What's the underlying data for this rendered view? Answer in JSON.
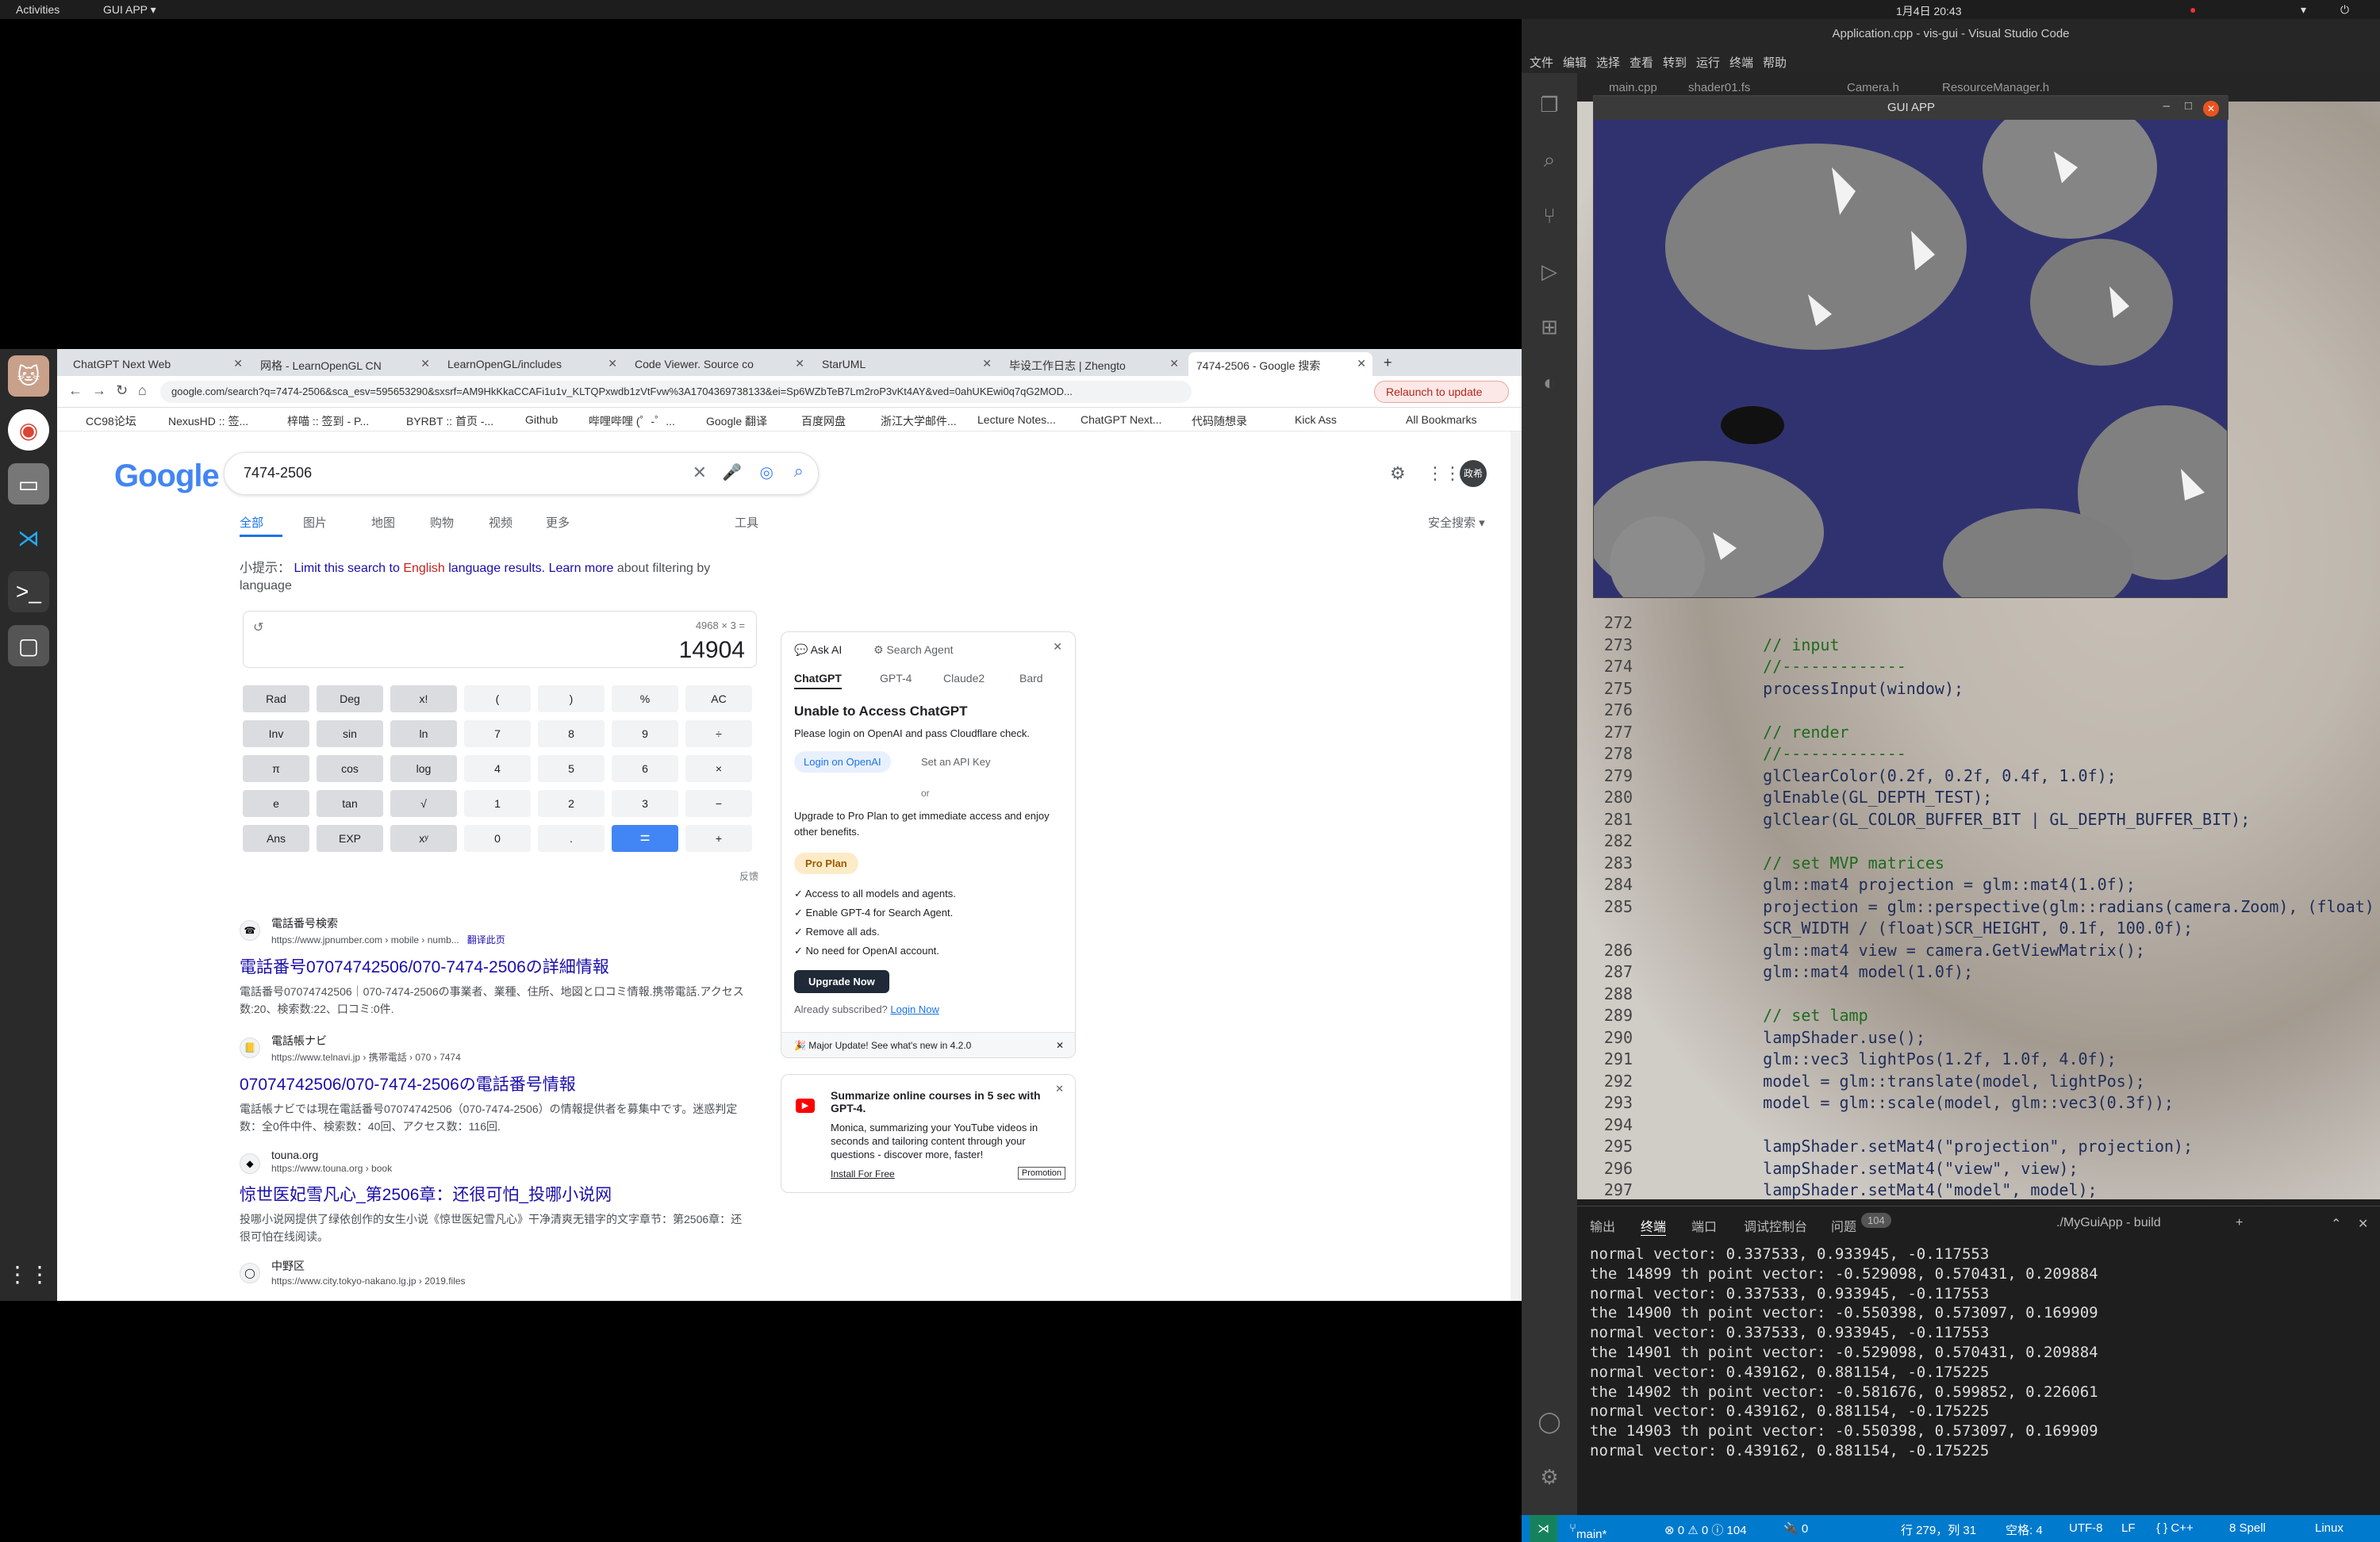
{
  "topbar": {
    "activities": "Activities",
    "app_menu": "GUI APP ▾",
    "datetime": "1月4日  20:43"
  },
  "chrome": {
    "tabs": [
      {
        "label": "ChatGPT Next Web"
      },
      {
        "label": "网格 - LearnOpenGL CN"
      },
      {
        "label": "LearnOpenGL/includes"
      },
      {
        "label": "Code Viewer. Source co"
      },
      {
        "label": "StarUML"
      },
      {
        "label": "毕设工作日志 | Zhengto"
      },
      {
        "label": "7474-2506 - Google 搜索"
      }
    ],
    "url": "google.com/search?q=7474-2506&sca_esv=595653290&sxsrf=AM9HkKkaCCAFi1u1v_KLTQPxwdb1zVtFvw%3A1704369738133&ei=Sp6WZbTeB7Lm2roP3vKt4AY&ved=0ahUKEwi0q7qG2MOD...",
    "relaunch": "Relaunch to update",
    "bookmarks": [
      "CC98论坛",
      "NexusHD :: 签...",
      "梓喵 :: 签到 - P...",
      "BYRBT :: 首页 -...",
      "Github",
      "哔哩哔哩 (゜-゜...",
      "Google 翻译",
      "百度网盘",
      "浙江大学邮件...",
      "Lecture Notes...",
      "ChatGPT Next...",
      "代码随想录",
      "Kick Ass",
      "All Bookmarks"
    ]
  },
  "google": {
    "logo": "Google",
    "query": "7474-2506",
    "nav": [
      "全部",
      "图片",
      "地图",
      "购物",
      "视频",
      "更多"
    ],
    "tools": "工具",
    "safesearch": "安全搜索 ▾",
    "avatar": "政希",
    "hint_prefix": "小提示：",
    "hint_link1": "Limit this search to",
    "hint_lang": "English",
    "hint_link2": "language results.",
    "hint_link3": "Learn more",
    "hint_suffix": "about filtering by language",
    "calc_expr": "4968 × 3 =",
    "calc_result": "14904",
    "calc_keys": [
      "Rad",
      "Deg",
      "x!",
      "(",
      ")",
      "%",
      "AC",
      "Inv",
      "sin",
      "ln",
      "7",
      "8",
      "9",
      "÷",
      "π",
      "cos",
      "log",
      "4",
      "5",
      "6",
      "×",
      "e",
      "tan",
      "√",
      "1",
      "2",
      "3",
      "−",
      "Ans",
      "EXP",
      "xʸ",
      "0",
      ".",
      "=",
      "+"
    ],
    "feedback": "反馈",
    "results": [
      {
        "site": "電話番号検索",
        "url": "https://www.jpnumber.com › mobile › numb...",
        "translate": "翻译此页",
        "title": "電話番号07074742506/070-7474-2506の詳細情報",
        "snippet": "電話番号07074742506｜070-7474-2506の事業者、業種、住所、地図と口コミ情報.携帯電話.アクセス数:20、検索数:22、口コミ:0件."
      },
      {
        "site": "電話帳ナビ",
        "url": "https://www.telnavi.jp › 携帯電話 › 070 › 7474",
        "translate": "",
        "title": "07074742506/070-7474-2506の電話番号情報",
        "snippet": "電話帳ナビでは現在電話番号07074742506（070-7474-2506）の情報提供者を募集中です。迷惑判定数：全0件中件、検索数：40回、アクセス数：116回."
      },
      {
        "site": "touna.org",
        "url": "https://www.touna.org › book",
        "translate": "",
        "title": "惊世医妃雪凡心_第2506章：还很可怕_投哪小说网",
        "snippet": "投哪小说网提供了绿依创作的女生小说《惊世医妃雪凡心》干净清爽无错字的文字章节：第2506章：还很可怕在线阅读。"
      },
      {
        "site": "中野区",
        "url": "https://www.city.tokyo-nakano.lg.jp › 2019.files",
        "translate": "",
        "title": "",
        "snippet": ""
      }
    ],
    "ai_panel": {
      "ask_ai": "Ask AI",
      "search_agent": "Search Agent",
      "models": [
        "ChatGPT",
        "GPT-4",
        "Claude2",
        "Bard"
      ],
      "heading": "Unable to Access ChatGPT",
      "message": "Please login on OpenAI and pass Cloudflare check.",
      "login_btn": "Login on OpenAI",
      "api_key": "Set an API Key",
      "or": "or",
      "upgrade_text": "Upgrade to Pro Plan to get immediate access and enjoy other benefits.",
      "pro_plan": "Pro Plan",
      "benefits": [
        "Access to all models and agents.",
        "Enable GPT-4 for Search Agent.",
        "Remove all ads.",
        "No need for OpenAI account."
      ],
      "upgrade_btn": "Upgrade Now",
      "already": "Already subscribed?",
      "login_now": "Login Now",
      "update": "🎉 Major Update! See what's new in 4.2.0"
    },
    "promo": {
      "title": "Summarize online courses in 5 sec with GPT-4.",
      "body": "Monica, summarizing your YouTube videos in seconds and tailoring content through your questions - discover more, faster!",
      "install": "Install For Free",
      "badge": "Promotion"
    }
  },
  "gui_app": {
    "title": "GUI APP"
  },
  "vscode": {
    "title": "Application.cpp - vis-gui - Visual Studio Code",
    "menu": [
      "文件",
      "编辑",
      "选择",
      "查看",
      "转到",
      "运行",
      "终端",
      "帮助"
    ],
    "tabs_visible": [
      "main.cpp",
      "shader01.fs",
      "Camera.h",
      "ResourceManager.h"
    ],
    "code": [
      {
        "n": "272",
        "t": ""
      },
      {
        "n": "273",
        "t": "    // input"
      },
      {
        "n": "274",
        "t": "    //-------------"
      },
      {
        "n": "275",
        "t": "    processInput(window);"
      },
      {
        "n": "276",
        "t": ""
      },
      {
        "n": "277",
        "t": "    // render"
      },
      {
        "n": "278",
        "t": "    //-------------"
      },
      {
        "n": "279",
        "t": "    glClearColor(0.2f, 0.2f, 0.4f, 1.0f);"
      },
      {
        "n": "280",
        "t": "    glEnable(GL_DEPTH_TEST);"
      },
      {
        "n": "281",
        "t": "    glClear(GL_COLOR_BUFFER_BIT | GL_DEPTH_BUFFER_BIT);"
      },
      {
        "n": "282",
        "t": ""
      },
      {
        "n": "283",
        "t": "    // set MVP matrices"
      },
      {
        "n": "284",
        "t": "    glm::mat4 projection = glm::mat4(1.0f);"
      },
      {
        "n": "285",
        "t": "    projection = glm::perspective(glm::radians(camera.Zoom), (float)"
      },
      {
        "n": "",
        "t": "    SCR_WIDTH / (float)SCR_HEIGHT, 0.1f, 100.0f);"
      },
      {
        "n": "286",
        "t": "    glm::mat4 view = camera.GetViewMatrix();"
      },
      {
        "n": "287",
        "t": "    glm::mat4 model(1.0f);"
      },
      {
        "n": "288",
        "t": ""
      },
      {
        "n": "289",
        "t": "    // set lamp"
      },
      {
        "n": "290",
        "t": "    lampShader.use();"
      },
      {
        "n": "291",
        "t": "    glm::vec3 lightPos(1.2f, 1.0f, 4.0f);"
      },
      {
        "n": "292",
        "t": "    model = glm::translate(model, lightPos);"
      },
      {
        "n": "293",
        "t": "    model = glm::scale(model, glm::vec3(0.3f));"
      },
      {
        "n": "294",
        "t": ""
      },
      {
        "n": "295",
        "t": "    lampShader.setMat4(\"projection\", projection);"
      },
      {
        "n": "296",
        "t": "    lampShader.setMat4(\"view\", view);"
      },
      {
        "n": "297",
        "t": "    lampShader.setMat4(\"model\", model);"
      },
      {
        "n": "298",
        "t": ""
      }
    ],
    "panel_tabs": [
      "输出",
      "终端",
      "端口",
      "调试控制台",
      "问题"
    ],
    "problems_count": "104",
    "terminal_name": "./MyGuiApp - build",
    "terminal_lines": [
      "normal vector: 0.337533, 0.933945, -0.117553",
      "the 14899 th point vector: -0.529098, 0.570431, 0.209884",
      "normal vector: 0.337533, 0.933945, -0.117553",
      "the 14900 th point vector: -0.550398, 0.573097, 0.169909",
      "normal vector: 0.337533, 0.933945, -0.117553",
      "the 14901 th point vector: -0.529098, 0.570431, 0.209884",
      "normal vector: 0.439162, 0.881154, -0.175225",
      "the 14902 th point vector: -0.581676, 0.599852, 0.226061",
      "normal vector: 0.439162, 0.881154, -0.175225",
      "the 14903 th point vector: -0.550398, 0.573097, 0.169909",
      "normal vector: 0.439162, 0.881154, -0.175225"
    ],
    "status": {
      "branch": "main*",
      "errors": "⊗ 0 ⚠ 0 ⓘ 104",
      "ports": "🔌 0",
      "position": "行 279，列 31",
      "spaces": "空格: 4",
      "encoding": "UTF-8",
      "eol": "LF",
      "lang": "{ } C++",
      "spell": "8 Spell",
      "os": "Linux"
    }
  }
}
